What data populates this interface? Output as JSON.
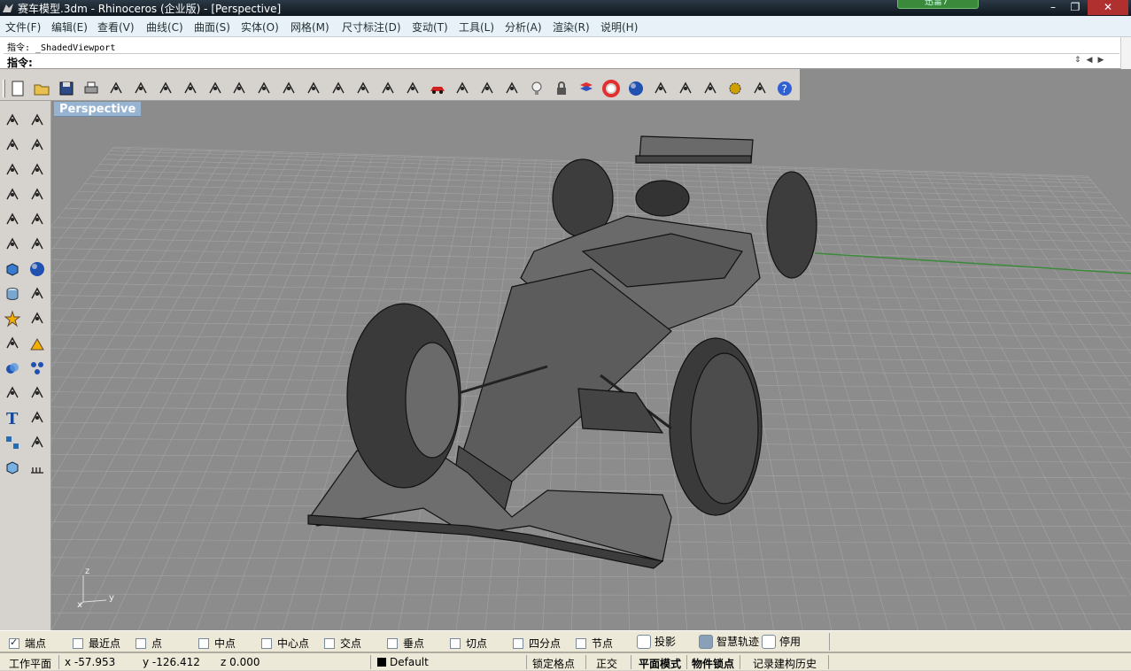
{
  "window": {
    "title": "赛车模型.3dm - Rhinoceros (企业版) - [Perspective]",
    "promo_label": "迅雷7",
    "minimize": "–",
    "restore": "❐",
    "close": "✕"
  },
  "menu": [
    "文件(F)",
    "编辑(E)",
    "查看(V)",
    "曲线(C)",
    "曲面(S)",
    "实体(O)",
    "网格(M)",
    "尺寸标注(D)",
    "变动(T)",
    "工具(L)",
    "分析(A)",
    "渲染(R)",
    "说明(H)"
  ],
  "command": {
    "history": "指令: _ShadedViewport",
    "prompt": "指令:",
    "scroll_arrows": "⇕◀▶"
  },
  "toolbar_icons": [
    "new-icon",
    "open-icon",
    "save-icon",
    "print-icon",
    "import-icon",
    "cut-icon",
    "copy-icon",
    "paste-icon",
    "undo-icon",
    "pan-icon",
    "rotate-view-icon",
    "zoom-icon",
    "zoom-window-icon",
    "zoom-extents-icon",
    "zoom-selected-icon",
    "rotate-icon",
    "four-view-icon",
    "car-icon",
    "grid-icon",
    "point-icon",
    "osnap-icon",
    "light-icon",
    "lock-icon",
    "layer-icon",
    "color-wheel-icon",
    "sphere-icon",
    "mesh-sphere-icon",
    "render-icon",
    "pen-icon",
    "gear-icon",
    "snap-icon",
    "help-icon"
  ],
  "left_tools": [
    [
      "select-icon",
      "point-icon"
    ],
    [
      "polyline-icon",
      "curve-icon"
    ],
    [
      "circle-icon",
      "ellipse-icon"
    ],
    [
      "arc-icon",
      "rectangle-icon"
    ],
    [
      "polygon-icon",
      "fillet-icon"
    ],
    [
      "surface-icon",
      "loft-icon"
    ],
    [
      "box-icon",
      "sphere-icon"
    ],
    [
      "cylinder-icon",
      "mesh-icon"
    ],
    [
      "explode-icon",
      "trim-icon"
    ],
    [
      "split-icon",
      "extend-icon"
    ],
    [
      "boolean-icon",
      "array-icon"
    ],
    [
      "rotate-icon",
      "bend-icon"
    ],
    [
      "text-icon",
      "dimension-icon"
    ],
    [
      "group-icon",
      "properties-icon"
    ],
    [
      "solid-icon",
      "hatch-icon"
    ]
  ],
  "viewport": {
    "label": "Perspective",
    "axes": {
      "z": "z",
      "y": "y",
      "x": "x"
    }
  },
  "osnaps": [
    {
      "label": "端点",
      "checked": true
    },
    {
      "label": "最近点",
      "checked": false
    },
    {
      "label": "点",
      "checked": false
    },
    {
      "label": "中点",
      "checked": false
    },
    {
      "label": "中心点",
      "checked": false
    },
    {
      "label": "交点",
      "checked": false
    },
    {
      "label": "垂点",
      "checked": false
    },
    {
      "label": "切点",
      "checked": false
    },
    {
      "label": "四分点",
      "checked": false
    },
    {
      "label": "节点",
      "checked": false
    }
  ],
  "toggles": [
    {
      "label": "投影",
      "on": false
    },
    {
      "label": "智慧轨迹",
      "on": true
    },
    {
      "label": "停用",
      "on": false
    }
  ],
  "status": {
    "cplane": "工作平面",
    "x": "x -57.953",
    "y": "y -126.412",
    "z": "z 0.000",
    "layer": "Default",
    "grid_snap": "锁定格点",
    "ortho": "正交",
    "planar": "平面模式",
    "osnap": "物件锁点",
    "history": "记录建构历史"
  },
  "colors": {
    "viewport_bg": "#8c8c8c",
    "vp_title": "#96b4d2",
    "grid": "#a4a4a4",
    "y_axis": "#3a8a3a"
  }
}
